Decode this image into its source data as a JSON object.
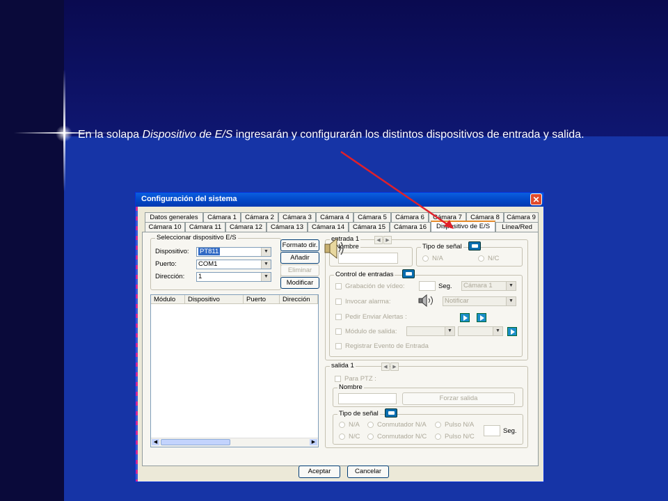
{
  "slide": {
    "caption_pre": "En la solapa ",
    "caption_em": "Dispositivo de E/S",
    "caption_post": " ingresarán y configurarán los distintos dispositivos de entrada y salida."
  },
  "colors": {
    "accent_arrow": "#e0202a",
    "title_bar": "#0348c8",
    "dialog_bg": "#ece9d8"
  },
  "dialog": {
    "title": "Configuración del sistema",
    "close_glyph": "✕",
    "tabs_row1": [
      "Datos generales",
      "Cámara 1",
      "Cámara 2",
      "Cámara 3",
      "Cámara 4",
      "Cámara 5",
      "Cámara 6",
      "Cámara 7",
      "Cámara 8",
      "Cámara 9"
    ],
    "tabs_row2": [
      "Cámara 10",
      "Cámara 11",
      "Cámara 12",
      "Cámara 13",
      "Cámara 14",
      "Cámara 15",
      "Cámara 16",
      "Dispositivo de E/S",
      "Línea/Red"
    ],
    "select_group": {
      "title": "Seleccionar dispositivo E/S",
      "device_label": "Dispositivo:",
      "device_value": "PT811",
      "port_label": "Puerto:",
      "port_value": "COM1",
      "address_label": "Dirección:",
      "address_value": "1",
      "btn_format": "Formato dir.",
      "btn_add": "Añadir",
      "btn_delete": "Eliminar",
      "btn_modify": "Modificar"
    },
    "table": {
      "columns": [
        "Módulo",
        "Dispositivo",
        "Puerto",
        "Dirección"
      ]
    },
    "input_group": {
      "title": "entrada 1",
      "name_label": "Nombre",
      "signal_title": "Tipo de señal",
      "na": "N/A",
      "nc": "N/C",
      "control_title": "Control de entradas",
      "video_rec": "Grabación de vídeo:",
      "seg": "Seg.",
      "camera_value": "Cámara 1",
      "alarm": "Invocar alarma:",
      "notify_value": "Notificar",
      "alerts": "Pedir Enviar Alertas :",
      "output_module": "Módulo de salida:",
      "register_event": "Registrar Evento de Entrada"
    },
    "output_group": {
      "title": "salida 1",
      "ptz": "Para PTZ :",
      "name_label": "Nombre",
      "force_output": "Forzar salida",
      "signal_title": "Tipo de señal",
      "na": "N/A",
      "switch_na": "Conmutador N/A",
      "pulse_na": "Pulso N/A",
      "nc": "N/C",
      "switch_nc": "Conmutador N/C",
      "pulse_nc": "Pulso N/C",
      "seg": "Seg."
    },
    "btn_accept": "Aceptar",
    "btn_cancel": "Cancelar"
  }
}
